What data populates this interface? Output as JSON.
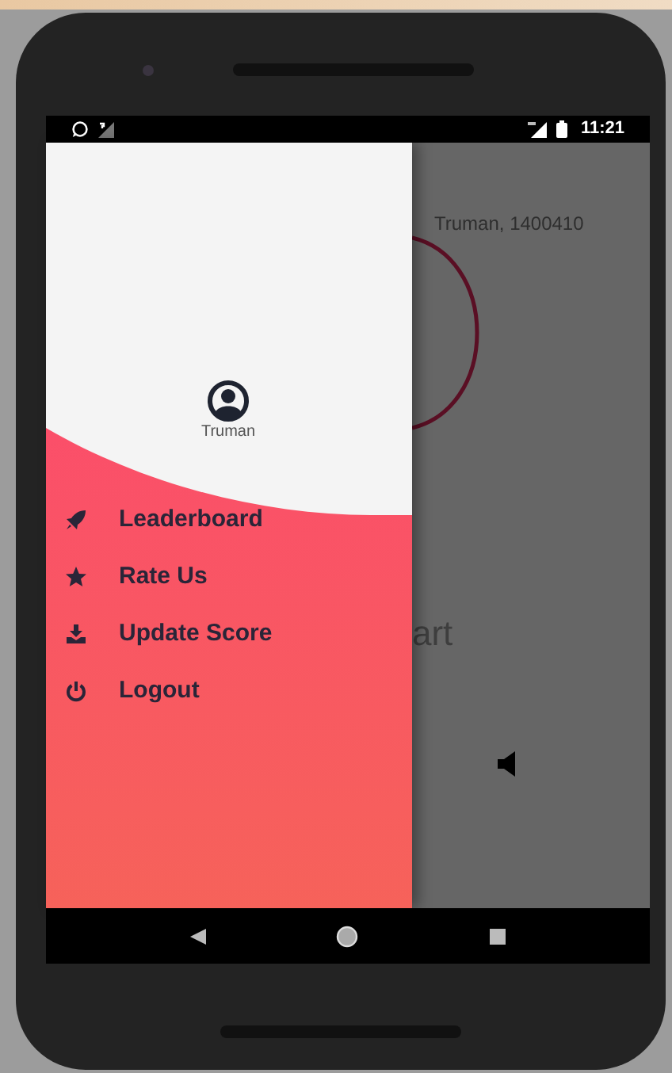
{
  "status_bar": {
    "time": "11:21"
  },
  "drawer": {
    "user_name": "Truman",
    "menu": [
      {
        "label": "Leaderboard",
        "kind": "rocket"
      },
      {
        "label": "Rate Us",
        "kind": "star"
      },
      {
        "label": "Update Score",
        "kind": "download"
      },
      {
        "label": "Logout",
        "kind": "power"
      }
    ]
  },
  "main": {
    "header_text": "Truman, 1400410",
    "button_text": "art"
  }
}
